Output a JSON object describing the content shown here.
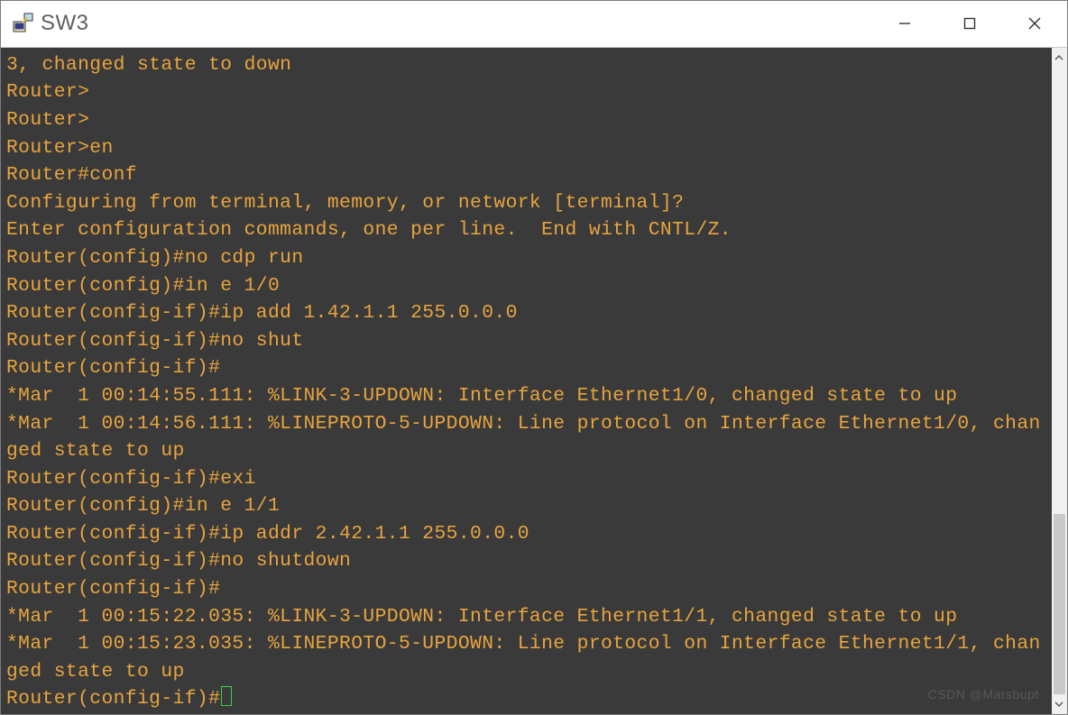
{
  "window": {
    "title": "SW3"
  },
  "terminal": {
    "lines": [
      "3, changed state to down",
      "Router>",
      "Router>",
      "Router>en",
      "Router#conf",
      "Configuring from terminal, memory, or network [terminal]?",
      "Enter configuration commands, one per line.  End with CNTL/Z.",
      "Router(config)#no cdp run",
      "Router(config)#in e 1/0",
      "Router(config-if)#ip add 1.42.1.1 255.0.0.0",
      "Router(config-if)#no shut",
      "Router(config-if)#",
      "*Mar  1 00:14:55.111: %LINK-3-UPDOWN: Interface Ethernet1/0, changed state to up",
      "*Mar  1 00:14:56.111: %LINEPROTO-5-UPDOWN: Line protocol on Interface Ethernet1/0, changed state to up",
      "Router(config-if)#exi",
      "Router(config)#in e 1/1",
      "Router(config-if)#ip addr 2.42.1.1 255.0.0.0",
      "Router(config-if)#no shutdown",
      "Router(config-if)#",
      "*Mar  1 00:15:22.035: %LINK-3-UPDOWN: Interface Ethernet1/1, changed state to up",
      "*Mar  1 00:15:23.035: %LINEPROTO-5-UPDOWN: Line protocol on Interface Ethernet1/1, changed state to up",
      "Router(config-if)#"
    ]
  },
  "watermark": "CSDN @Marsbupt"
}
